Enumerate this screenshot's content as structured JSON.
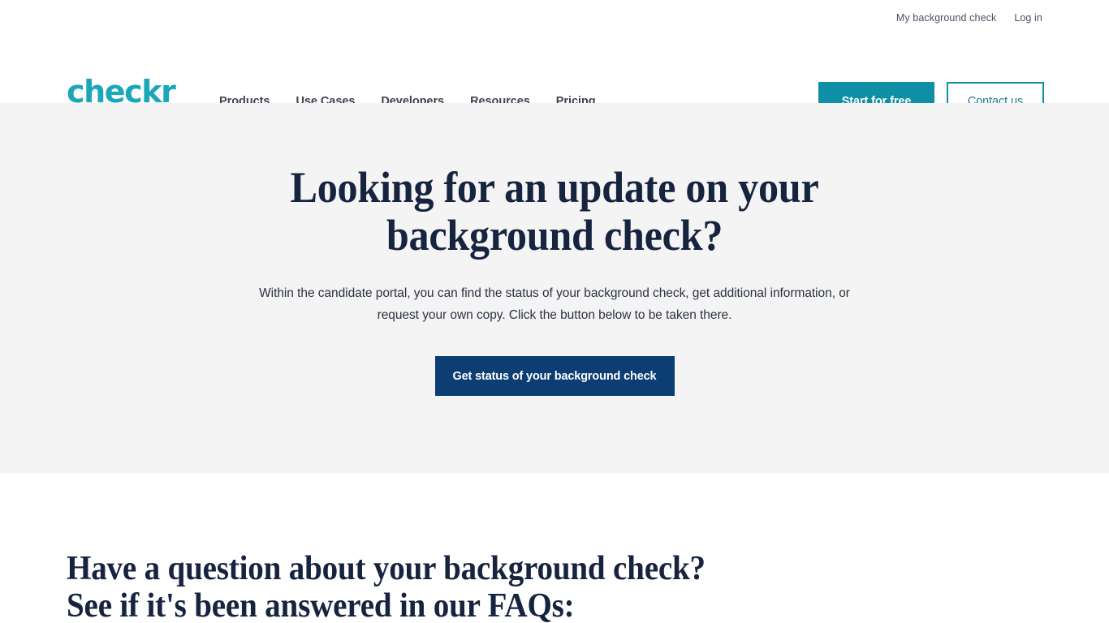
{
  "brand": {
    "logo_text": "checkr",
    "logo_color": "#1BA7BA",
    "navy": "#16243F",
    "teal": "#0F8FA5",
    "button_navy": "#0C3D73",
    "hero_bg": "#F4F4F4"
  },
  "header": {
    "utility_links": [
      {
        "label": "My background check"
      },
      {
        "label": "Log in"
      }
    ],
    "nav_items": [
      {
        "label": "Products"
      },
      {
        "label": "Use Cases"
      },
      {
        "label": "Developers"
      },
      {
        "label": "Resources"
      },
      {
        "label": "Pricing"
      }
    ],
    "cta_primary": "Start for free",
    "cta_secondary": "Contact us"
  },
  "hero": {
    "title": "Looking for an update on your background check?",
    "subtitle": "Within the candidate portal, you can find the status of your background check, get additional information, or request your own copy. Click the button below to be taken there.",
    "cta_label": "Get status of your background check"
  },
  "faq": {
    "heading_line1": "Have a question about your background check?",
    "heading_line2": "See if it's been answered in our FAQs:"
  }
}
